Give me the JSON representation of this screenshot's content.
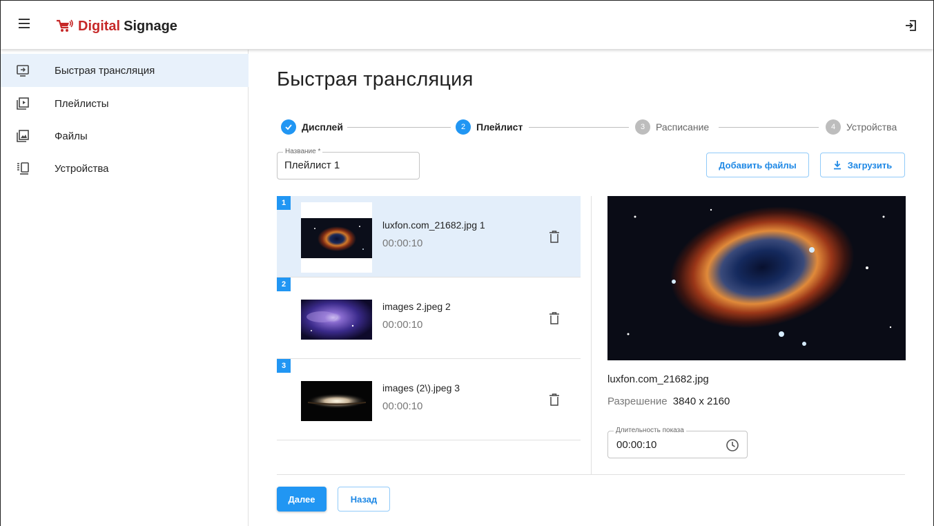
{
  "header": {
    "brand_part1": "Digital",
    "brand_part2": "Signage",
    "logo_icon": "cart-broadcast-icon",
    "logout_icon": "logout-icon"
  },
  "sidebar": {
    "items": [
      {
        "label": "Быстрая трансляция",
        "icon": "cast-screen-icon",
        "active": true
      },
      {
        "label": "Плейлисты",
        "icon": "playlist-play-icon",
        "active": false
      },
      {
        "label": "Файлы",
        "icon": "image-file-icon",
        "active": false
      },
      {
        "label": "Устройства",
        "icon": "devices-icon",
        "active": false
      }
    ]
  },
  "main": {
    "title": "Быстрая трансляция",
    "steps": [
      {
        "num": "1",
        "label": "Дисплей",
        "state": "done"
      },
      {
        "num": "2",
        "label": "Плейлист",
        "state": "current"
      },
      {
        "num": "3",
        "label": "Расписание",
        "state": "pending"
      },
      {
        "num": "4",
        "label": "Устройства",
        "state": "pending"
      }
    ],
    "name_field": {
      "label": "Название *",
      "value": "Плейлист 1"
    },
    "add_files_label": "Добавить файлы",
    "upload_label": "Загрузить",
    "playlist": [
      {
        "num": "1",
        "name": "luxfon.com_21682.jpg 1",
        "duration": "00:00:10",
        "selected": true,
        "thumb": "helix-nebula"
      },
      {
        "num": "2",
        "name": "images 2.jpeg 2",
        "duration": "00:00:10",
        "selected": false,
        "thumb": "purple-nebula"
      },
      {
        "num": "3",
        "name": "images (2\\).jpeg 3",
        "duration": "00:00:10",
        "selected": false,
        "thumb": "sombrero-galaxy"
      }
    ],
    "preview": {
      "file_name": "luxfon.com_21682.jpg",
      "resolution_label": "Разрешение",
      "resolution_value": "3840 x 2160",
      "duration_label": "Длительность показа",
      "duration_value": "00:00:10"
    },
    "next_label": "Далее",
    "back_label": "Назад"
  },
  "colors": {
    "accent": "#2196f3",
    "brand_red": "#c62828",
    "selected_bg": "#e3eefa"
  }
}
